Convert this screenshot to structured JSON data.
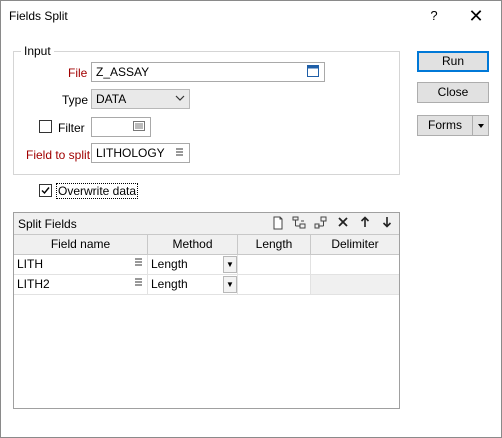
{
  "window": {
    "title": "Fields Split",
    "help_label": "?",
    "close_label": "✕"
  },
  "input": {
    "legend": "Input",
    "file_label": "File",
    "file_value": "Z_ASSAY",
    "type_label": "Type",
    "type_value": "DATA",
    "filter_label": "Filter",
    "filter_value": "",
    "field_to_split_label": "Field to split",
    "field_to_split_value": "LITHOLOGY"
  },
  "overwrite": {
    "label": "Overwrite data",
    "checked": true
  },
  "buttons": {
    "run": "Run",
    "close": "Close",
    "forms": "Forms"
  },
  "split_fields": {
    "title": "Split Fields",
    "columns": [
      "Field name",
      "Method",
      "Length",
      "Delimiter"
    ],
    "rows": [
      {
        "field_name": "LITH",
        "method": "Length",
        "length": "",
        "delimiter": ""
      },
      {
        "field_name": "LITH2",
        "method": "Length",
        "length": "",
        "delimiter": ""
      }
    ]
  }
}
